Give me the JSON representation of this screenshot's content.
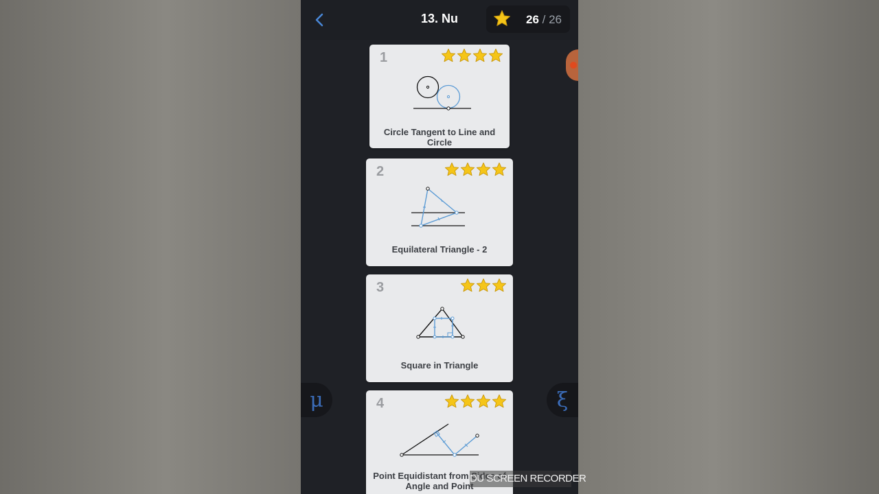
{
  "header": {
    "title": "13. Nu",
    "score_earned": "26",
    "score_total": "/ 26"
  },
  "levels": [
    {
      "number": "1",
      "title": "Circle Tangent to Line and Circle",
      "stars": 4
    },
    {
      "number": "2",
      "title": "Equilateral Triangle - 2",
      "stars": 4
    },
    {
      "number": "3",
      "title": "Square in Triangle",
      "stars": 3
    },
    {
      "number": "4",
      "title": "Point Equidistant from Sides of Angle and Point",
      "stars": 4
    }
  ],
  "tools": {
    "left_symbol": "μ",
    "right_symbol": "ξ"
  },
  "watermark": "DU SCREEN RECORDER",
  "colors": {
    "accent_blue": "#5b9bd5",
    "star_gold": "#f5c518",
    "background_dark": "#1f2126",
    "card_bg": "#e9eaec"
  },
  "icons": {
    "back": "chevron-left-icon",
    "score": "star-icon"
  }
}
